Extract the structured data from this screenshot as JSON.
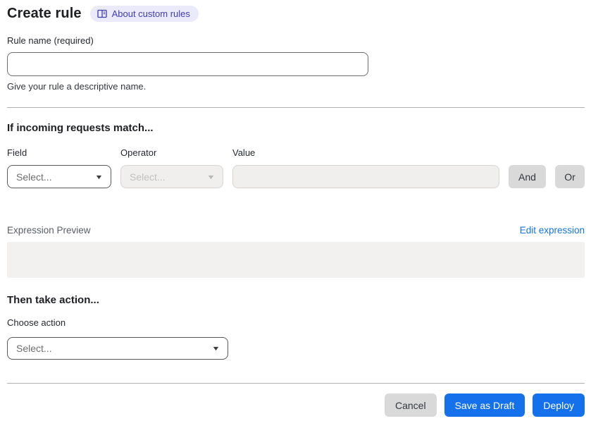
{
  "header": {
    "title": "Create rule",
    "about_badge": "About custom rules"
  },
  "rule_name": {
    "label": "Rule name (required)",
    "value": "",
    "helper": "Give your rule a descriptive name."
  },
  "match_section": {
    "title": "If incoming requests match...",
    "field_label": "Field",
    "operator_label": "Operator",
    "value_label": "Value",
    "field_placeholder": "Select...",
    "operator_placeholder": "Select...",
    "value_value": "",
    "and_label": "And",
    "or_label": "Or"
  },
  "expression": {
    "label": "Expression Preview",
    "edit_link": "Edit expression",
    "content": ""
  },
  "action_section": {
    "title": "Then take action...",
    "choose_label": "Choose action",
    "action_placeholder": "Select..."
  },
  "footer": {
    "cancel_label": "Cancel",
    "save_draft_label": "Save as Draft",
    "deploy_label": "Deploy"
  },
  "colors": {
    "primary_blue": "#1570ec",
    "link_blue": "#1474e6",
    "badge_bg": "#ebeafa",
    "badge_text": "#3e3cb4",
    "gray_button": "#d9d9d9",
    "disabled_bg": "#f0efee",
    "preview_bg": "#f2f1ef"
  }
}
